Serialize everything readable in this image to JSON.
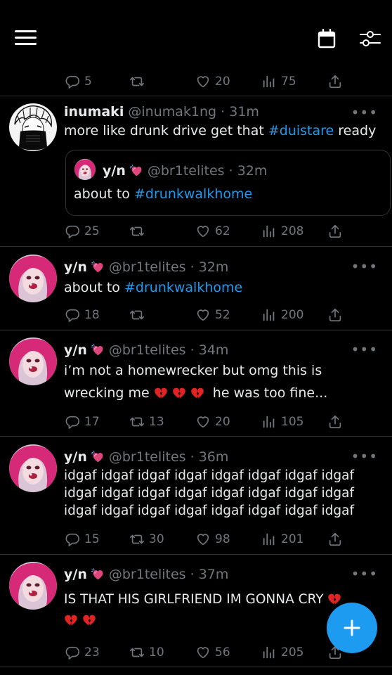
{
  "colors": {
    "background": "#000000",
    "accent": "#1d9bf0",
    "muted": "#71767b",
    "text": "#e7e9ea",
    "divider": "#2f3336"
  },
  "topbar": {
    "left_icon": "hamburger-menu-icon",
    "right_icons": [
      "calendar-icon",
      "filter-sliders-icon"
    ]
  },
  "top_actions": {
    "replies": "5",
    "retweets": "",
    "likes": "20",
    "views": "75"
  },
  "tweets": [
    {
      "name": "inumaki",
      "handle": "@inumak1ng",
      "time": "· 31m",
      "text_before": "more like drunk drive get that ",
      "hashtag": "#duistare",
      "text_after": " ready",
      "quote": {
        "name": "y/n",
        "handle": "@br1telites",
        "time": "· 32m",
        "text_before": "about to ",
        "hashtag": "#drunkwalkhome"
      },
      "replies": "25",
      "retweets": "",
      "likes": "62",
      "views": "208"
    },
    {
      "name": "y/n",
      "handle": "@br1telites",
      "time": "· 32m",
      "text_before": "about to ",
      "hashtag": "#drunkwalkhome",
      "replies": "18",
      "retweets": "",
      "likes": "52",
      "views": "200"
    },
    {
      "name": "y/n",
      "handle": "@br1telites",
      "time": "· 34m",
      "line1": "i’m not a homewrecker but omg this is",
      "line2_before": "wrecking me",
      "line2_after": "he was too fine...",
      "replies": "17",
      "retweets": "13",
      "likes": "20",
      "views": "105"
    },
    {
      "name": "y/n",
      "handle": "@br1telites",
      "time": "· 36m",
      "lines": [
        "idgaf idgaf idgaf idgaf idgaf idgaf idgaf idgaf",
        "idgaf idgaf idgaf idgaf idgaf idgaf idgaf idgaf",
        "idgaf idgaf idgaf idgaf idgaf idgaf idgaf idgaf"
      ],
      "replies": "15",
      "retweets": "30",
      "likes": "98",
      "views": "201"
    },
    {
      "name": "y/n",
      "handle": "@br1telites",
      "time": "· 37m",
      "text": "IS THAT HIS GIRLFRIEND IM GONNA CRY",
      "replies": "23",
      "retweets": "10",
      "likes": "56",
      "views": "205"
    }
  ],
  "more_label": "•••",
  "fab": {
    "icon": "plus-icon",
    "label": "+"
  }
}
